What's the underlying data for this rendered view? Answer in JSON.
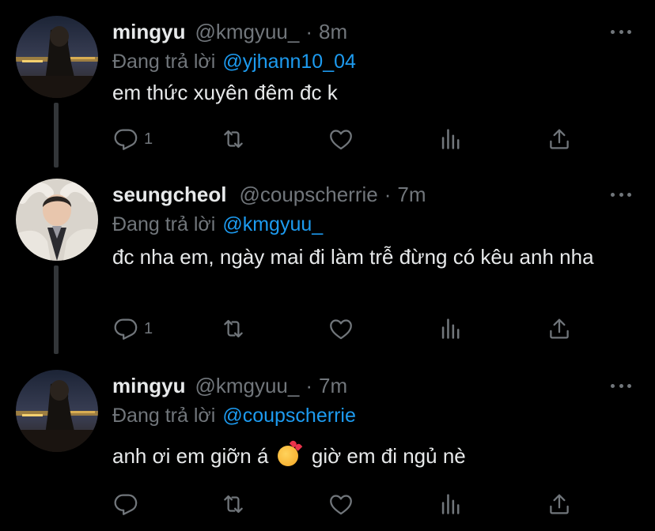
{
  "tweets": [
    {
      "name": "mingyu",
      "handle": "@kmgyuu_",
      "separator": "·",
      "time": "8m",
      "reply_prefix": "Đang trả lời",
      "reply_to": "@yjhann10_04",
      "text": "em thức xuyên đêm đc k",
      "reply_count": "1",
      "avatar_icon": "profile-photo-night-city"
    },
    {
      "name": "seungcheol",
      "handle": "@coupscherrie",
      "separator": "·",
      "time": "7m",
      "reply_prefix": "Đang trả lời",
      "reply_to": "@kmgyuu_",
      "text": "đc nha em, ngày mai đi làm trễ đừng có kêu anh nha",
      "reply_count": "1",
      "avatar_icon": "profile-photo-portrait"
    },
    {
      "name": "mingyu",
      "handle": "@kmgyuu_",
      "separator": "·",
      "time": "7m",
      "reply_prefix": "Đang trả lời",
      "reply_to": "@coupscherrie",
      "text_before": "anh ơi em giỡn á",
      "text_emoji": "smiling-face-with-hearts",
      "text_after": "giờ em đi ngủ nè",
      "reply_count": "",
      "avatar_icon": "profile-photo-night-city"
    }
  ],
  "colors": {
    "background": "#000000",
    "text_primary": "#e7e9ea",
    "text_secondary": "#71767b",
    "accent": "#1d9bf0",
    "thread_line": "#333639"
  },
  "action_icons": [
    "reply-icon",
    "retweet-icon",
    "like-icon",
    "analytics-icon",
    "share-icon"
  ]
}
